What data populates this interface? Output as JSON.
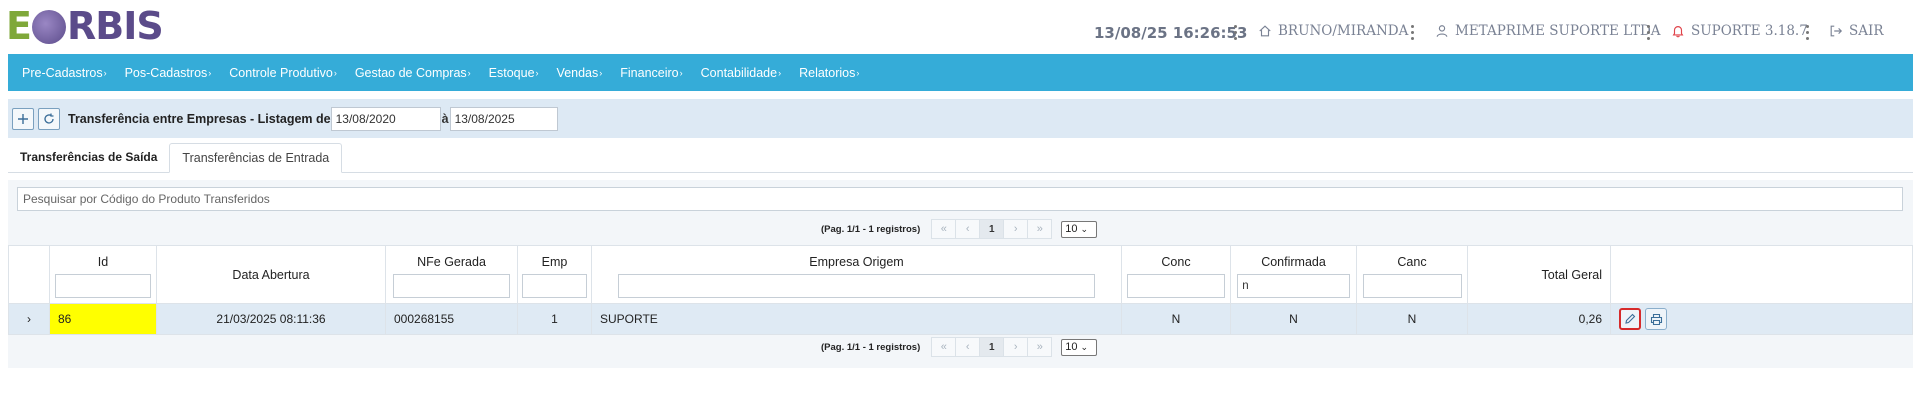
{
  "header": {
    "logo_e": "E",
    "logo_rest": "RBIS",
    "datetime": "13/08/25 16:26:53",
    "user": "BRUNO/MIRANDA",
    "company": "METAPRIME SUPORTE LTDA",
    "version": "SUPORTE 3.18.7",
    "logout": "SAIR",
    "icons": [
      "home-icon",
      "user-icon",
      "bell-icon",
      "logout-icon"
    ]
  },
  "menu": [
    "Pre-Cadastros",
    "Pos-Cadastros",
    "Controle Produtivo",
    "Gestao de Compras",
    "Estoque",
    "Vendas",
    "Financeiro",
    "Contabilidade",
    "Relatorios"
  ],
  "toolbar": {
    "title": "Transferência entre Empresas - Listagem de",
    "date_from": "13/08/2020",
    "sep": "à",
    "date_to": "13/08/2025"
  },
  "tabs": [
    {
      "label": "Transferências de Saída",
      "active": false
    },
    {
      "label": "Transferências de Entrada",
      "active": true
    }
  ],
  "search": {
    "placeholder": "Pesquisar por Código do Produto Transferidos"
  },
  "pager": {
    "info": "(Pag. 1/1 - 1 registros)",
    "first": "«",
    "prev": "‹",
    "current": "1",
    "next": "›",
    "last": "»",
    "page_size": "10"
  },
  "table": {
    "columns": [
      "Id",
      "Data Abertura",
      "NFe Gerada",
      "Emp",
      "Empresa Origem",
      "Conc",
      "Confirmada",
      "Canc",
      "Total Geral"
    ],
    "filters": {
      "confirmada": "n"
    },
    "rows": [
      {
        "expander": "›",
        "id": "86",
        "data_abertura": "21/03/2025 08:11:36",
        "nfe_gerada": "000268155",
        "emp": "1",
        "empresa_origem": "SUPORTE",
        "conc": "N",
        "confirmada": "N",
        "canc": "N",
        "total_geral": "0,26"
      }
    ]
  },
  "colors": {
    "menu_bg": "#35acd8",
    "toolbar_bg": "#dde9f4",
    "row_bg": "#dfeaf4",
    "id_highlight": "#ffff00",
    "selected_action_border": "#d62b2b"
  }
}
